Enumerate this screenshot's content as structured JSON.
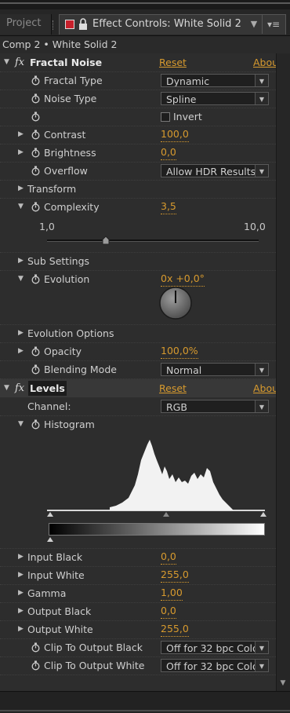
{
  "tabs": {
    "project": "Project",
    "effect_controls": "Effect Controls: White Solid 2",
    "close": "▼",
    "menu": "▾≡"
  },
  "breadcrumb": "Comp 2 • White Solid 2",
  "fractal_noise": {
    "fx": "fx",
    "title": "Fractal Noise",
    "reset": "Reset",
    "about": "Abou",
    "fractal_type": {
      "label": "Fractal Type",
      "value": "Dynamic"
    },
    "noise_type": {
      "label": "Noise Type",
      "value": "Spline"
    },
    "invert": {
      "label": "Invert",
      "checked": false
    },
    "contrast": {
      "label": "Contrast",
      "value": "100,0"
    },
    "brightness": {
      "label": "Brightness",
      "value": "0,0"
    },
    "overflow": {
      "label": "Overflow",
      "value": "Allow HDR Results"
    },
    "transform": {
      "label": "Transform"
    },
    "complexity": {
      "label": "Complexity",
      "value": "3,5",
      "slider_min": "1,0",
      "slider_max": "10,0",
      "slider_position": 0.278
    },
    "sub_settings": {
      "label": "Sub Settings"
    },
    "evolution": {
      "label": "Evolution",
      "value": "0x +0,0°"
    },
    "evolution_options": {
      "label": "Evolution Options"
    },
    "opacity": {
      "label": "Opacity",
      "value": "100,0%"
    },
    "blending_mode": {
      "label": "Blending Mode",
      "value": "Normal"
    }
  },
  "levels": {
    "fx": "fx",
    "title": "Levels",
    "reset": "Reset",
    "about": "Abou",
    "channel": {
      "label": "Channel:",
      "value": "RGB"
    },
    "histogram": {
      "label": "Histogram"
    },
    "input_black": {
      "label": "Input Black",
      "value": "0,0"
    },
    "input_white": {
      "label": "Input White",
      "value": "255,0"
    },
    "gamma": {
      "label": "Gamma",
      "value": "1,00"
    },
    "output_black": {
      "label": "Output Black",
      "value": "0,0"
    },
    "output_white": {
      "label": "Output White",
      "value": "255,0"
    },
    "clip_black": {
      "label": "Clip To Output Black",
      "value": "Off for 32 bpc Colo"
    },
    "clip_white": {
      "label": "Clip To Output White",
      "value": "Off for 32 bpc Colo"
    }
  },
  "colors": {
    "accent": "#d79a2e",
    "panel": "#2d2d2d",
    "red_label": "#c8202b"
  },
  "icons": {
    "stopwatch": "stopwatch-icon",
    "lock": "lock-icon",
    "twirl": "twirl-triangle-icon"
  }
}
